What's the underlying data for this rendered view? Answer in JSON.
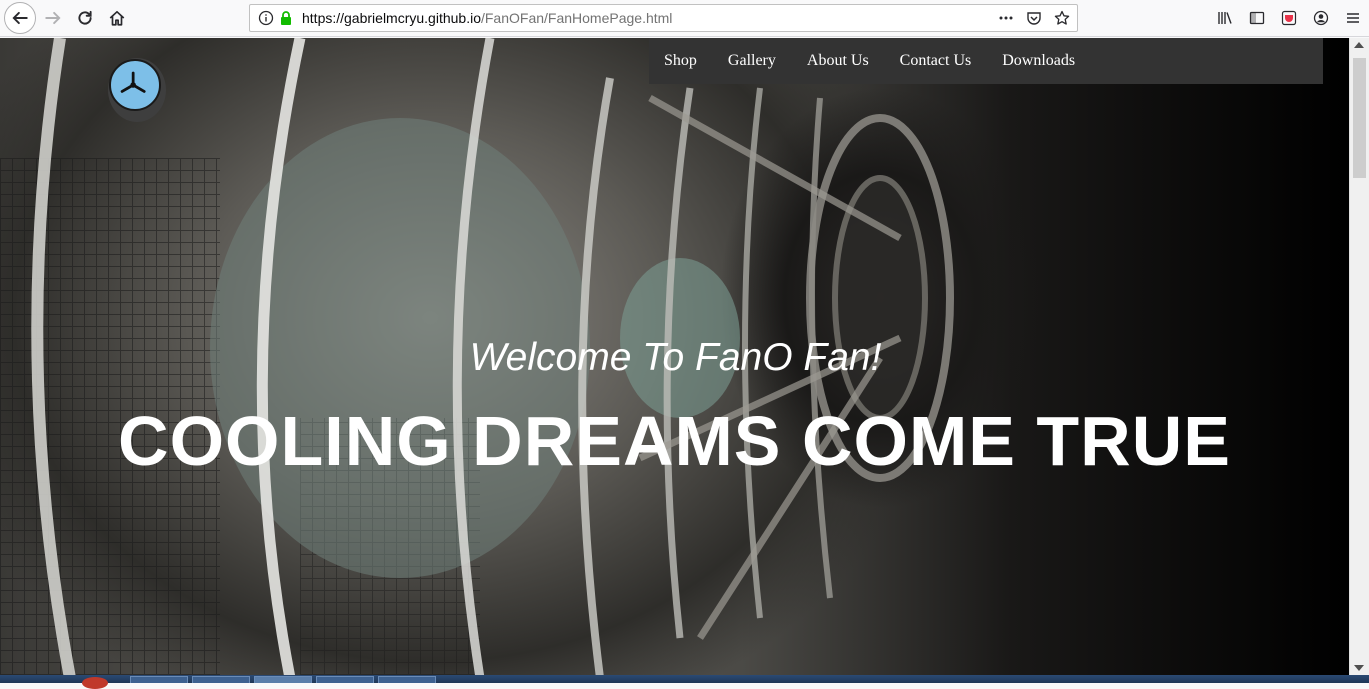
{
  "browser": {
    "url_host": "https://gabrielmcryu.github.io",
    "url_path": "/FanOFan/FanHomePage.html"
  },
  "nav": {
    "items": [
      "Shop",
      "Gallery",
      "About Us",
      "Contact Us",
      "Downloads"
    ]
  },
  "hero": {
    "welcome": "Welcome To FanO Fan!",
    "headline": "COOLING DREAMS COME TRUE"
  },
  "colors": {
    "nav_bg": "#333333",
    "logo_blue": "#7dbfe8"
  }
}
